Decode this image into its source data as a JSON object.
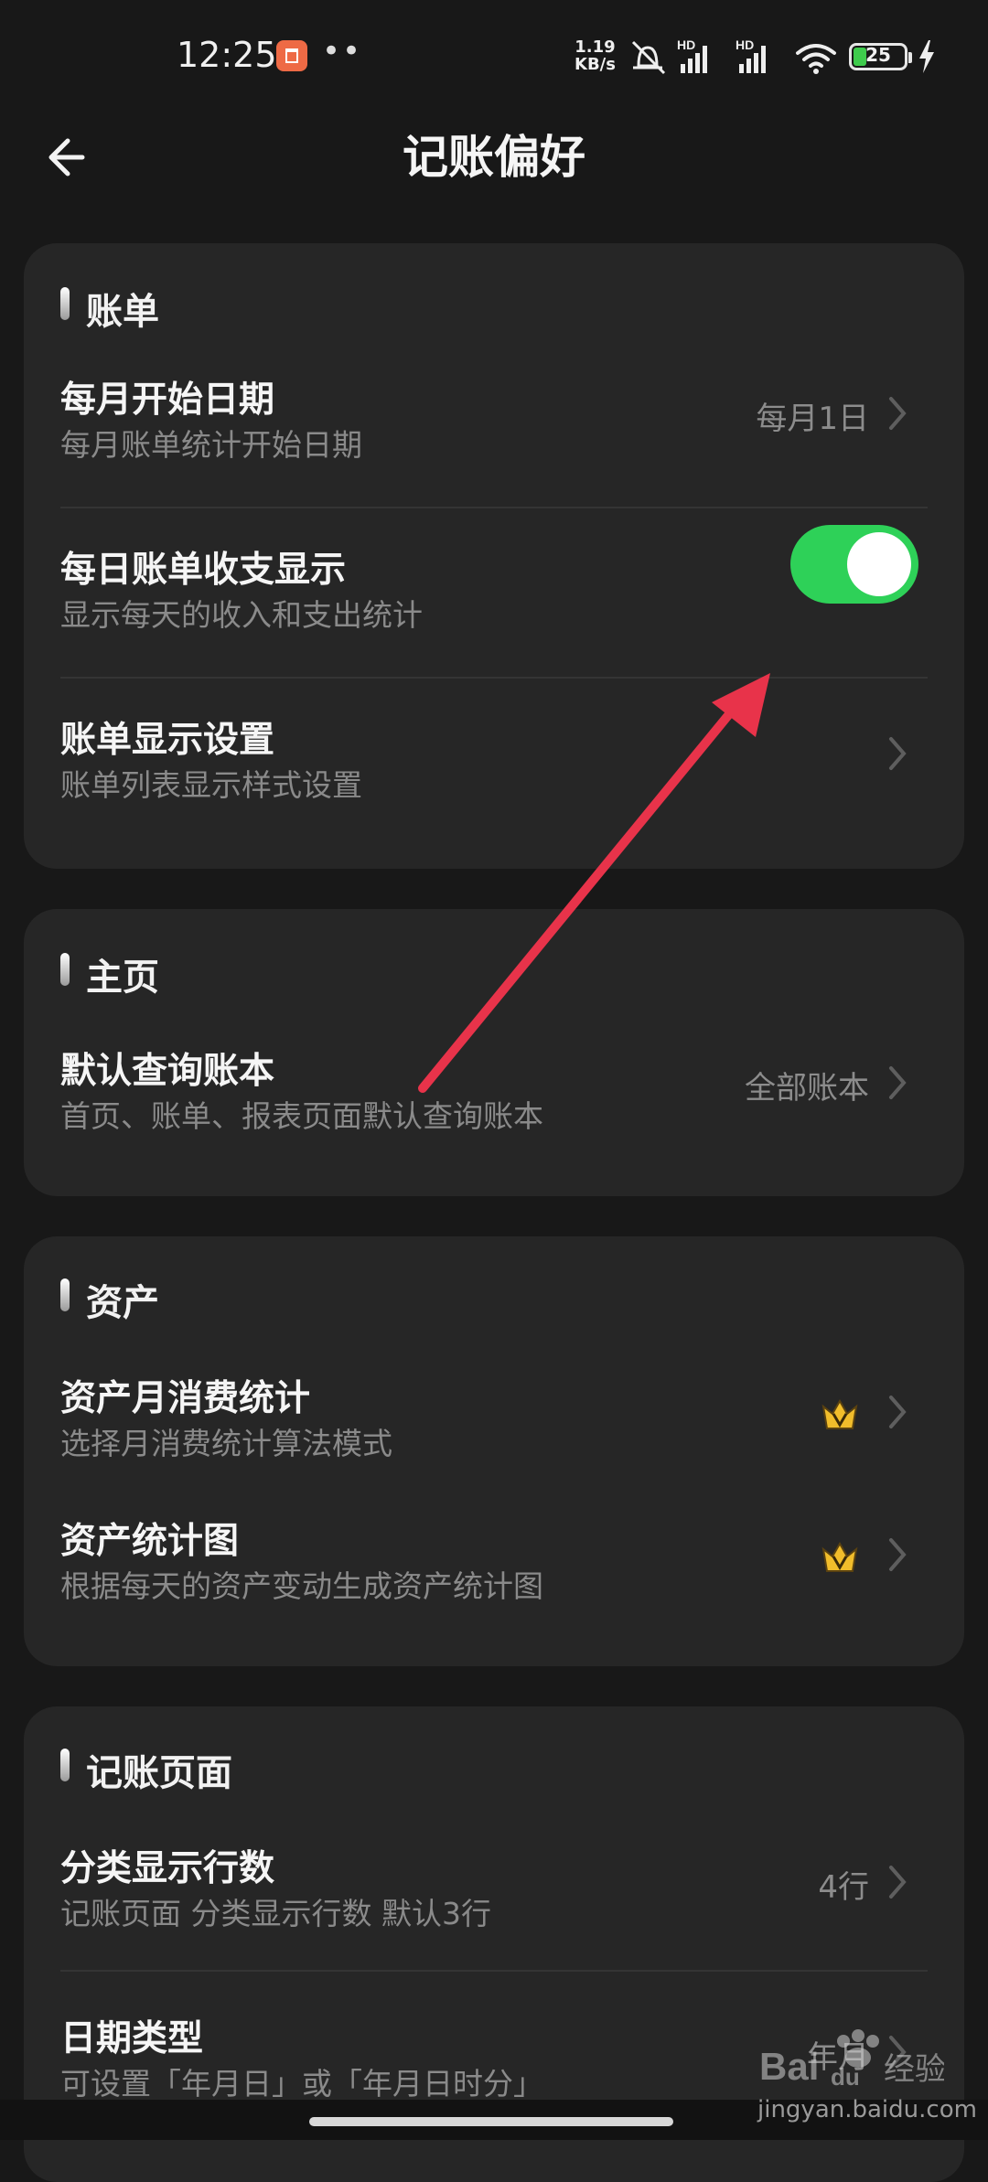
{
  "status_bar": {
    "time": "12:25",
    "dots": "••",
    "net_speed_value": "1.19",
    "net_speed_unit": "KB/s",
    "battery_level": "25",
    "signal_1_label": "HD",
    "signal_2_label": "HD"
  },
  "header": {
    "title": "记账偏好"
  },
  "sections": [
    {
      "title": "账单",
      "rows": [
        {
          "title": "每月开始日期",
          "subtitle": "每月账单统计开始日期",
          "value": "每月1日"
        },
        {
          "title": "每日账单收支显示",
          "subtitle": "显示每天的收入和支出统计",
          "toggle_on": true
        },
        {
          "title": "账单显示设置",
          "subtitle": "账单列表显示样式设置",
          "value": ""
        }
      ]
    },
    {
      "title": "主页",
      "rows": [
        {
          "title": "默认查询账本",
          "subtitle": "首页、账单、报表页面默认查询账本",
          "value": "全部账本"
        }
      ]
    },
    {
      "title": "资产",
      "rows": [
        {
          "title": "资产月消费统计",
          "subtitle": "选择月消费统计算法模式",
          "vip": true
        },
        {
          "title": "资产统计图",
          "subtitle": "根据每天的资产变动生成资产统计图",
          "vip": true
        }
      ]
    },
    {
      "title": "记账页面",
      "rows": [
        {
          "title": "分类显示行数",
          "subtitle": "记账页面 分类显示行数 默认3行",
          "value": "4行"
        },
        {
          "title": "日期类型",
          "subtitle": "可设置「年月日」或「年月日时分」",
          "value": "年月"
        }
      ]
    }
  ],
  "watermark": {
    "brand": "Bai",
    "brand_suffix": "du",
    "product": "经验",
    "url": "jingyan.baidu.com"
  },
  "colors": {
    "background": "#181818",
    "card": "#262626",
    "toggle_on": "#2ed158",
    "annotation_arrow": "#e8334a",
    "crown": "#f1bd2b"
  }
}
